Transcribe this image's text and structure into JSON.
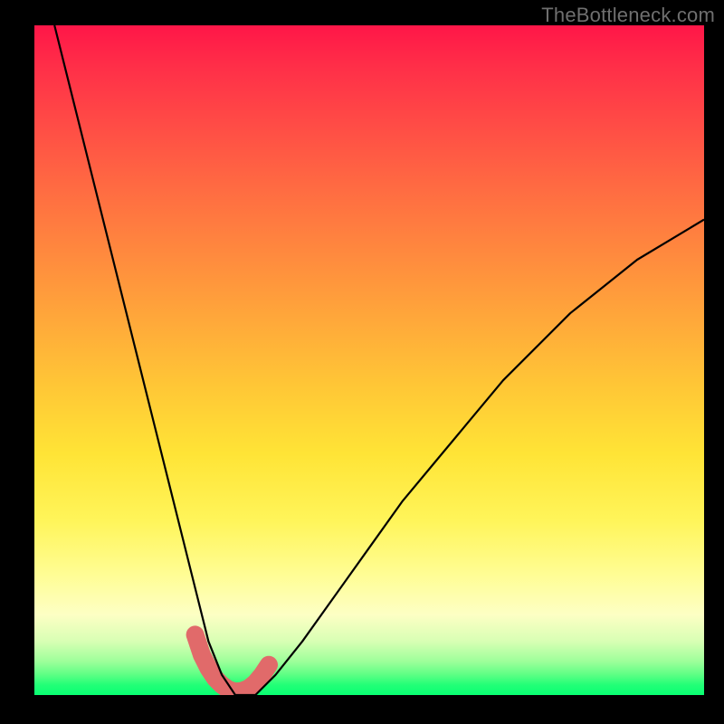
{
  "watermark": "TheBottleneck.com",
  "chart_data": {
    "type": "line",
    "title": "",
    "xlabel": "",
    "ylabel": "",
    "xlim": [
      0,
      100
    ],
    "ylim": [
      0,
      100
    ],
    "grid": false,
    "series": [
      {
        "name": "bottleneck-curve",
        "x": [
          3,
          6,
          9,
          12,
          15,
          18,
          20,
          22,
          24,
          26,
          28,
          30,
          33,
          36,
          40,
          45,
          50,
          55,
          60,
          65,
          70,
          75,
          80,
          85,
          90,
          95,
          100
        ],
        "values": [
          100,
          88,
          76,
          64,
          52,
          40,
          32,
          24,
          16,
          8,
          3,
          0,
          0,
          3,
          8,
          15,
          22,
          29,
          35,
          41,
          47,
          52,
          57,
          61,
          65,
          68,
          71
        ]
      }
    ],
    "highlight": {
      "name": "trough-highlight",
      "color": "#e16a6a",
      "x": [
        24,
        25,
        26,
        27,
        28,
        29,
        30,
        31,
        32,
        33,
        34,
        35
      ],
      "values": [
        9,
        6,
        4,
        2.5,
        1.5,
        0.8,
        0.5,
        0.6,
        1.0,
        1.8,
        3.0,
        4.5
      ]
    }
  }
}
